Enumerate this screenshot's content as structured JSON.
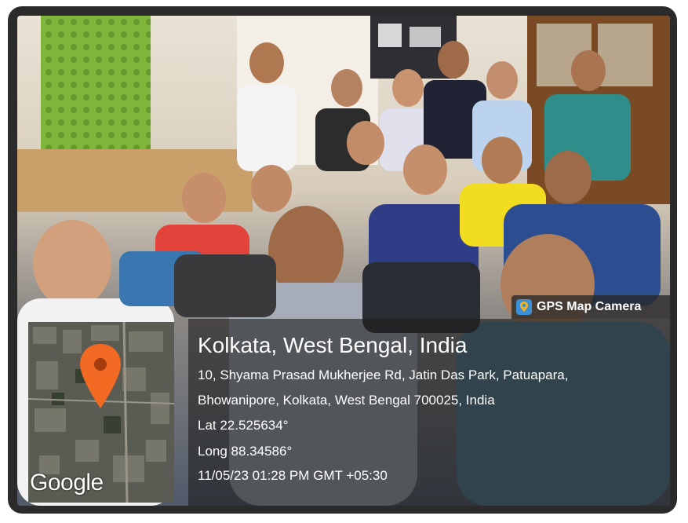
{
  "badge": {
    "icon": "map-pin-icon",
    "label": "GPS Map Camera"
  },
  "location": {
    "place": "Kolkata, West Bengal, India",
    "address_line1": "10, Shyama Prasad Mukherjee Rd, Jatin Das Park, Patuapara,",
    "address_line2": "Bhowanipore, Kolkata, West Bengal 700025, India",
    "lat": "Lat 22.525634°",
    "long": "Long 88.34586°",
    "timestamp": "11/05/23 01:28 PM GMT +05:30"
  },
  "map": {
    "logo": "Google",
    "pin_color": "#f26a21"
  }
}
